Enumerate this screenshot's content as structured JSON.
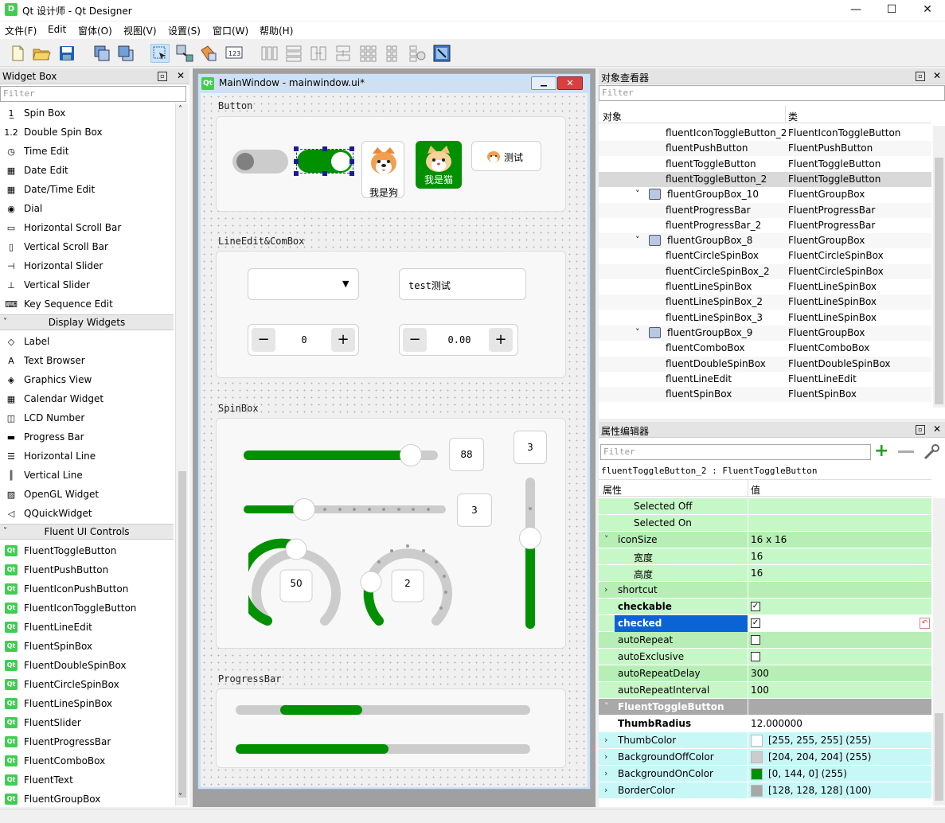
{
  "window": {
    "app_icon": "D",
    "title": "Qt 设计师 - Qt Designer",
    "minimize": "—",
    "maximize": "☐",
    "close": "✕"
  },
  "menu": [
    "文件(F)",
    "Edit",
    "窗体(O)",
    "视图(V)",
    "设置(S)",
    "窗口(W)",
    "帮助(H)"
  ],
  "widget_box": {
    "title": "Widget Box",
    "filter_placeholder": "Filter",
    "items_input": [
      {
        "label": "Spin Box",
        "icon": "spinbox-icon"
      },
      {
        "label": "Double Spin Box",
        "icon": "double-spinbox-icon"
      },
      {
        "label": "Time Edit",
        "icon": "clock-icon"
      },
      {
        "label": "Date Edit",
        "icon": "calendar-icon"
      },
      {
        "label": "Date/Time Edit",
        "icon": "datetime-icon"
      },
      {
        "label": "Dial",
        "icon": "dial-icon"
      },
      {
        "label": "Horizontal Scroll Bar",
        "icon": "hscroll-icon"
      },
      {
        "label": "Vertical Scroll Bar",
        "icon": "vscroll-icon"
      },
      {
        "label": "Horizontal Slider",
        "icon": "hslider-icon"
      },
      {
        "label": "Vertical Slider",
        "icon": "vslider-icon"
      },
      {
        "label": "Key Sequence Edit",
        "icon": "keyseq-icon"
      }
    ],
    "cat_display": "Display Widgets",
    "items_display": [
      {
        "label": "Label",
        "icon": "label-icon"
      },
      {
        "label": "Text Browser",
        "icon": "text-browser-icon"
      },
      {
        "label": "Graphics View",
        "icon": "graphics-view-icon"
      },
      {
        "label": "Calendar Widget",
        "icon": "calendar-widget-icon"
      },
      {
        "label": "LCD Number",
        "icon": "lcd-icon"
      },
      {
        "label": "Progress Bar",
        "icon": "progress-icon"
      },
      {
        "label": "Horizontal Line",
        "icon": "hline-icon"
      },
      {
        "label": "Vertical Line",
        "icon": "vline-icon"
      },
      {
        "label": "OpenGL Widget",
        "icon": "opengl-icon"
      },
      {
        "label": "QQuickWidget",
        "icon": "qquick-icon"
      }
    ],
    "cat_fluent": "Fluent UI Controls",
    "qt_badge": "Qt",
    "items_fluent": [
      "FluentToggleButton",
      "FluentPushButton",
      "FluentIconPushButton",
      "FluentIconToggleButton",
      "FluentLineEdit",
      "FluentSpinBox",
      "FluentDoubleSpinBox",
      "FluentCircleSpinBox",
      "FluentLineSpinBox",
      "FluentSlider",
      "FluentProgressBar",
      "FluentComboBox",
      "FluentText",
      "FluentGroupBox"
    ]
  },
  "form": {
    "window_title": "MainWindow - mainwindow.ui*",
    "qt_badge": "Qt",
    "group_button": "Button",
    "dog_label": "我是狗",
    "cat_label": "我是猫",
    "test_button": "测试",
    "group_lineedit": "LineEdit&ComBox",
    "lineedit_value": "test测试",
    "spin_int": "0",
    "spin_double": "0.00",
    "minus": "−",
    "plus": "+",
    "group_spinbox": "SpinBox",
    "slider1_value": "88",
    "slider1_level": 0.86,
    "slider2_value": "3",
    "slider2_level": 0.3,
    "vslider_value": "3",
    "vslider_level": 0.6,
    "circle1_value": "50",
    "circle2_value": "2",
    "group_progress": "ProgressBar",
    "progress1_start": 0.15,
    "progress1_end": 0.43,
    "progress2_level": 0.52
  },
  "object_inspector": {
    "title": "对象查看器",
    "filter_placeholder": "Filter",
    "col_object": "对象",
    "col_class": "类",
    "rows": [
      {
        "obj": "fluentIconToggleButton_2",
        "cls": "FluentIconToggleButton",
        "level": 2
      },
      {
        "obj": "fluentPushButton",
        "cls": "FluentPushButton",
        "level": 2
      },
      {
        "obj": "fluentToggleButton",
        "cls": "FluentToggleButton",
        "level": 2
      },
      {
        "obj": "fluentToggleButton_2",
        "cls": "FluentToggleButton",
        "level": 2,
        "selected": true
      },
      {
        "obj": "fluentGroupBox_10",
        "cls": "FluentGroupBox",
        "level": 1
      },
      {
        "obj": "fluentProgressBar",
        "cls": "FluentProgressBar",
        "level": 2
      },
      {
        "obj": "fluentProgressBar_2",
        "cls": "FluentProgressBar",
        "level": 2
      },
      {
        "obj": "fluentGroupBox_8",
        "cls": "FluentGroupBox",
        "level": 1
      },
      {
        "obj": "fluentCircleSpinBox",
        "cls": "FluentCircleSpinBox",
        "level": 2
      },
      {
        "obj": "fluentCircleSpinBox_2",
        "cls": "FluentCircleSpinBox",
        "level": 2
      },
      {
        "obj": "fluentLineSpinBox",
        "cls": "FluentLineSpinBox",
        "level": 2
      },
      {
        "obj": "fluentLineSpinBox_2",
        "cls": "FluentLineSpinBox",
        "level": 2
      },
      {
        "obj": "fluentLineSpinBox_3",
        "cls": "FluentLineSpinBox",
        "level": 2
      },
      {
        "obj": "fluentGroupBox_9",
        "cls": "FluentGroupBox",
        "level": 1
      },
      {
        "obj": "fluentComboBox",
        "cls": "FluentComboBox",
        "level": 2
      },
      {
        "obj": "fluentDoubleSpinBox",
        "cls": "FluentDoubleSpinBox",
        "level": 2
      },
      {
        "obj": "fluentLineEdit",
        "cls": "FluentLineEdit",
        "level": 2
      },
      {
        "obj": "fluentSpinBox",
        "cls": "FluentSpinBox",
        "level": 2
      }
    ]
  },
  "property_editor": {
    "title": "属性编辑器",
    "filter_placeholder": "Filter",
    "object_label": "fluentToggleButton_2 : FluentToggleButton",
    "col_property": "属性",
    "col_value": "值",
    "rows": [
      {
        "prop": "Selected Off",
        "val": "",
        "indent": 2,
        "bg": "green"
      },
      {
        "prop": "Selected On",
        "val": "",
        "indent": 2,
        "bg": "green"
      },
      {
        "prop": "iconSize",
        "val": "16 x 16",
        "indent": 1,
        "bg": "green2",
        "expander": "˅"
      },
      {
        "prop": "宽度",
        "val": "16",
        "indent": 2,
        "bg": "green"
      },
      {
        "prop": "高度",
        "val": "16",
        "indent": 2,
        "bg": "green"
      },
      {
        "prop": "shortcut",
        "val": "",
        "indent": 1,
        "bg": "green2",
        "expander": "›"
      },
      {
        "prop": "checkable",
        "val": "",
        "indent": 1,
        "bg": "green",
        "bold": true,
        "check": "✓"
      },
      {
        "prop": "checked",
        "val": "",
        "indent": 1,
        "bg": "sel",
        "bold": true,
        "check": "✓",
        "reset": "↶"
      },
      {
        "prop": "autoRepeat",
        "val": "",
        "indent": 1,
        "bg": "green2",
        "check": " "
      },
      {
        "prop": "autoExclusive",
        "val": "",
        "indent": 1,
        "bg": "green",
        "check": " "
      },
      {
        "prop": "autoRepeatDelay",
        "val": "300",
        "indent": 1,
        "bg": "green2"
      },
      {
        "prop": "autoRepeatInterval",
        "val": "100",
        "indent": 1,
        "bg": "green"
      },
      {
        "prop": "FluentToggleButton",
        "val": "",
        "indent": 1,
        "bg": "header",
        "expander": "˅"
      },
      {
        "prop": "ThumbRadius",
        "val": "12.000000",
        "indent": 1,
        "bg": "white",
        "bold": true
      },
      {
        "prop": "ThumbColor",
        "val": "[255, 255, 255] (255)",
        "indent": 1,
        "bg": "cyan",
        "expander": "›",
        "swatch": "#ffffff"
      },
      {
        "prop": "BackgroundOffColor",
        "val": "[204, 204, 204] (255)",
        "indent": 1,
        "bg": "cyan",
        "expander": "›",
        "swatch": "#cccccc"
      },
      {
        "prop": "BackgroundOnColor",
        "val": "[0, 144, 0] (255)",
        "indent": 1,
        "bg": "cyan",
        "expander": "›",
        "swatch": "#009000"
      },
      {
        "prop": "BorderColor",
        "val": "[128, 128, 128] (100)",
        "indent": 1,
        "bg": "cyan",
        "expander": "›",
        "swatch": "#a8a8a8"
      }
    ]
  },
  "colors": {
    "accent": "#009000",
    "selection": "#0a64d6",
    "off": "#cccccc"
  }
}
